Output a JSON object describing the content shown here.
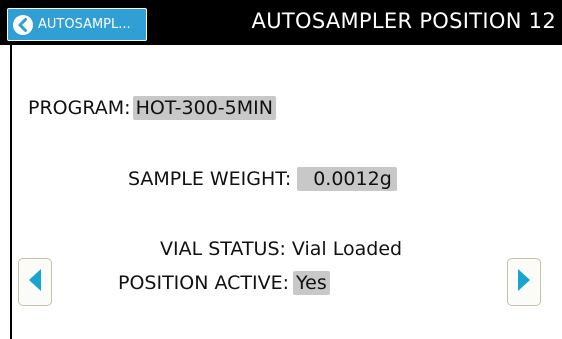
{
  "header": {
    "back_label": "AUTOSAMPL...",
    "title": "AUTOSAMPLER POSITION 12"
  },
  "fields": {
    "program_label": "PROGRAM:",
    "program_value": "HOT-300-5MIN",
    "weight_label": "SAMPLE WEIGHT:",
    "weight_value": "0.0012g",
    "vial_status_label": "VIAL STATUS:",
    "vial_status_value": "Vial Loaded",
    "position_active_label": "POSITION ACTIVE:",
    "position_active_value": "Yes"
  },
  "icons": {
    "back": "chevron-left-circle-icon",
    "prev": "triangle-left-icon",
    "next": "triangle-right-icon"
  },
  "colors": {
    "header_bg": "#000000",
    "accent": "#2f9fd6",
    "value_bg": "#c8c8c8"
  }
}
